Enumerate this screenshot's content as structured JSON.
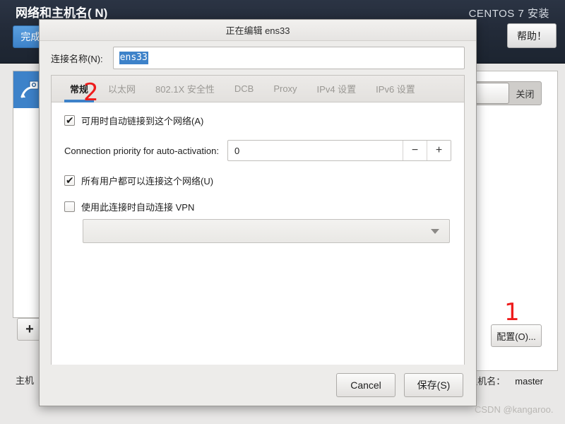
{
  "installer": {
    "page_title": "网络和主机名( N)",
    "brand": "CENTOS 7 安装",
    "done_button": "完成(D)",
    "help_button": "帮助！",
    "connection_icon": "ethernet-cable-icon",
    "add_button": "+",
    "switch_label": "关闭",
    "configure_button": "配置(O)...",
    "hostname_label_left": "主机",
    "hostname_label": "主机名：",
    "hostname_value": "master"
  },
  "dialog": {
    "title": "正在编辑 ens33",
    "name_label": "连接名称(N):",
    "name_value": "ens33",
    "tabs": [
      {
        "label": "常规",
        "active": true
      },
      {
        "label": "以太网",
        "active": false
      },
      {
        "label": "802.1X 安全性",
        "active": false
      },
      {
        "label": "DCB",
        "active": false
      },
      {
        "label": "Proxy",
        "active": false
      },
      {
        "label": "IPv4 设置",
        "active": false
      },
      {
        "label": "IPv6 设置",
        "active": false
      }
    ],
    "general": {
      "autoconnect_label": "可用时自动链接到这个网络(A)",
      "autoconnect_checked": true,
      "priority_label": "Connection priority for auto-activation:",
      "priority_value": "0",
      "priority_minus": "−",
      "priority_plus": "+",
      "allusers_label": "所有用户都可以连接这个网络(U)",
      "allusers_checked": true,
      "vpn_label": "使用此连接时自动连接 VPN",
      "vpn_checked": false,
      "vpn_select_value": ""
    },
    "cancel_button": "Cancel",
    "save_button": "保存(S)"
  },
  "annotations": {
    "marker_one": "1",
    "marker_two": "2",
    "accent_red": "#ee1c1c"
  },
  "watermark": "CSDN @kangaroo."
}
